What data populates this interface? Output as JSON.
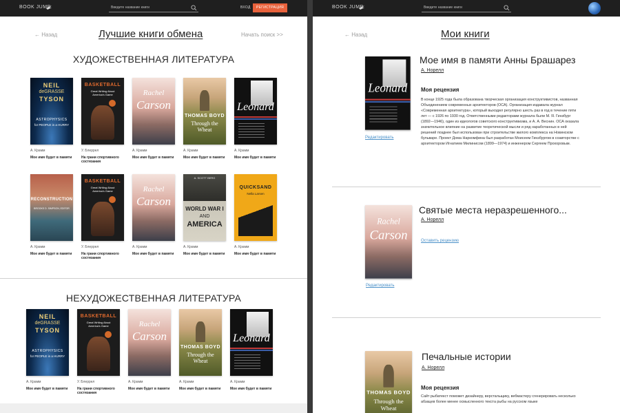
{
  "left": {
    "header": {
      "logo": "BOOK JUMP",
      "search_placeholder": "Введите название книги",
      "login": "ВХОД",
      "register": "РЕГИСТРАЦИЯ"
    },
    "back": "← Назад",
    "title": "Лучшие книги обмена",
    "next": "Начать поиск >>",
    "fiction_title": "ХУДОЖЕСТВЕННАЯ ЛИТЕРАТУРА",
    "nonfiction_title": "НЕХУДОЖЕСТВЕННАЯ ЛИТЕРАТУРА",
    "row1": [
      {
        "author": "А. Крамм",
        "title": "Мое имя будет в памяти",
        "cover": "tyson"
      },
      {
        "author": "У. Блеррел",
        "title": "На грани спортивного состязания",
        "cover": "basketball"
      },
      {
        "author": "А. Крамм",
        "title": "Мое имя будет в памяти",
        "cover": "carson"
      },
      {
        "author": "А. Крамм",
        "title": "Мое имя будет в памяти",
        "cover": "wheat"
      },
      {
        "author": "А. Крамм",
        "title": "Мое имя будет в памяти",
        "cover": "leonard"
      }
    ],
    "row2": [
      {
        "author": "А. Крамм",
        "title": "Мое имя будет в памяти",
        "cover": "reconstruction"
      },
      {
        "author": "У. Блеррел",
        "title": "На грани спортивного состязания",
        "cover": "basketball"
      },
      {
        "author": "А. Крамм",
        "title": "Мое имя будет в памяти",
        "cover": "carson"
      },
      {
        "author": "А. Крамм",
        "title": "Мое имя будет в памяти",
        "cover": "ww1"
      },
      {
        "author": "А. Крамм",
        "title": "Мое имя будет в памяти",
        "cover": "quicksand"
      }
    ],
    "row3": [
      {
        "author": "А. Крамм",
        "title": "Мое имя будет в памяти",
        "cover": "tyson"
      },
      {
        "author": "У. Блеррел",
        "title": "На грани спортивного состязания",
        "cover": "basketball"
      },
      {
        "author": "А. Крамм",
        "title": "Мое имя будет в памяти",
        "cover": "carson"
      },
      {
        "author": "А. Крамм",
        "title": "Мое имя будет в памяти",
        "cover": "wheat"
      },
      {
        "author": "А. Крамм",
        "title": "Мое имя будет в памяти",
        "cover": "leonard"
      }
    ]
  },
  "right": {
    "header": {
      "logo": "BOOK JUMP",
      "search_placeholder": "Введите название книги"
    },
    "back": "← Назад",
    "title": "Мои книги",
    "books": [
      {
        "title": "Мое имя в памяти Анны Брашарез",
        "author": "А. Норелл",
        "review_heading": "Моя рецензия",
        "review": "В конце 1925 года была образована творческая организация конструктивистов, названная Объединением современных архитекторов (ОСА). Организация издавала журнал «Современная архитектура», который выходил регулярно шесть раз в год в течение пяти лет — с 1926 по 1930 год. Ответственными редакторами журнала были М. Я. Гинзбург (1892—1946), один из идеологов советского конструктивизма, и А. А. Веснин. ОСА оказала значительное влияние на развитие теоретической мысли и ряд наработанных в ней решений позднее был использован при строительстве жилого комплекса на Новинском бульваре. Проект Дома Наркомфина был разработан Моисеем Гинзбургом в соавторстве с архитектором Игнатием Милинисом (1899—1974) и инженером Сергеем Прохоровым.",
        "edit": "Редактировать"
      },
      {
        "title": "Святые места неразрешенного...",
        "author": "А. Норелл",
        "leave_review": "Оставить рецензию",
        "edit": "Редактировать"
      },
      {
        "title": "Печальные истории",
        "author": "А. Норелл",
        "review_heading": "Моя рецензия",
        "review": "Сайт рыбатекст поможет дизайнеру, верстальщику, вебмастеру сгенерировать несколько абзацев более менее осмысленного текста рыбы на русском языке"
      }
    ]
  },
  "covers": {
    "tyson": {
      "l1": "NEIL",
      "l2": "deGRASSE",
      "l3": "TYSON",
      "l4": "ASTROPHYSICS",
      "l5": "for PEOPLE in a HURRY"
    },
    "basketball": {
      "l1": "BASKETBALL",
      "l2": "Great Writing About America's Game"
    },
    "carson": {
      "l1": "Rachel",
      "l2": "Carson"
    },
    "wheat": {
      "l1": "THOMAS BOYD",
      "l2": "Through the Wheat"
    },
    "leonard": {
      "l1": "Leonard"
    },
    "reconstruction": {
      "l1": "RECONSTRUCTION",
      "l2": "BROOKS D. SIMPSON, EDITOR"
    },
    "ww1": {
      "l1": "A. SCOTT BERG",
      "l2": "WORLD WAR I",
      "l3": "AND",
      "l4": "AMERICA"
    },
    "quicksand": {
      "l1": "QUICKSAND",
      "l2": "Nella Larsen"
    }
  }
}
